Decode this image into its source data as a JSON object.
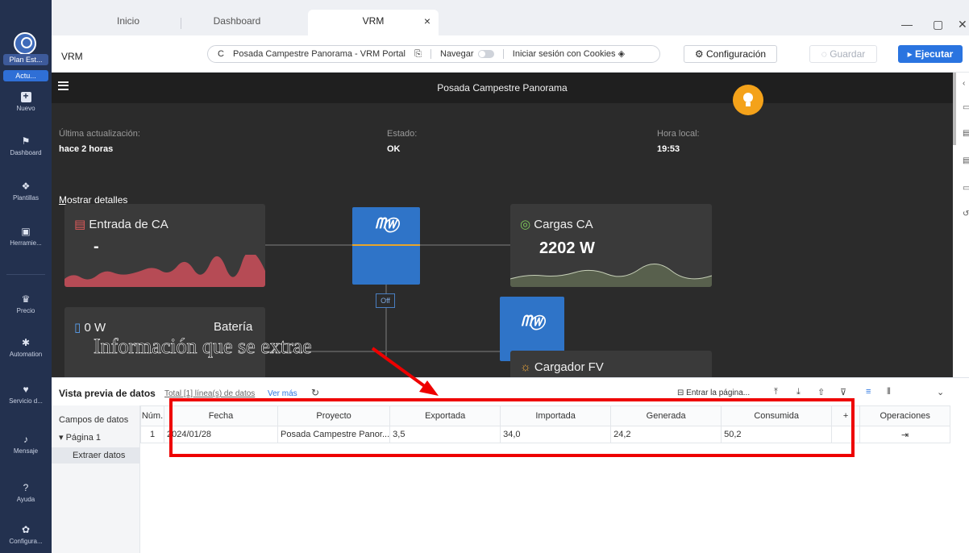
{
  "sidebar": {
    "plan_label": "Plan Est...",
    "active_label": "Actu...",
    "items": [
      {
        "label": "Nuevo",
        "icon": "plus-square-icon"
      },
      {
        "label": "Dashboard",
        "icon": "dashboard-icon"
      },
      {
        "label": "Plantillas",
        "icon": "templates-icon"
      },
      {
        "label": "Herramie...",
        "icon": "toolbox-icon"
      },
      {
        "label": "Precio",
        "icon": "crown-icon"
      },
      {
        "label": "Automation",
        "icon": "robot-icon"
      },
      {
        "label": "Servicio d...",
        "icon": "service-icon"
      },
      {
        "label": "Mensaje",
        "icon": "bell-icon"
      },
      {
        "label": "Ayuda",
        "icon": "help-icon"
      },
      {
        "label": "Configura...",
        "icon": "settings-icon"
      }
    ]
  },
  "tabs": [
    {
      "label": "Inicio"
    },
    {
      "label": "Dashboard"
    },
    {
      "label": "VRM",
      "close": "×"
    }
  ],
  "window": {
    "minimize": "—",
    "maximize": "▢",
    "close": "✕"
  },
  "toolbar": {
    "site_label": "VRM",
    "refresh_glyph": "C",
    "address": "Posada Campestre Panorama - VRM Portal",
    "navigate_label": "Navegar",
    "cookie_label": "Iniciar sesión con Cookies",
    "config_button": "Configuración",
    "save_button": "Guardar",
    "run_button": "Ejecutar"
  },
  "portal": {
    "title": "Posada Campestre Panorama",
    "last_update_label": "Última actualización:",
    "last_update_value": "hace 2 horas",
    "status_label": "Estado:",
    "status_value": "OK",
    "local_time_label": "Hora local:",
    "local_time_value": "19:53",
    "show_details": "Mostrar detalles",
    "cards": {
      "ac_input": {
        "title": "Entrada de CA",
        "value": "-"
      },
      "ac_loads": {
        "title": "Cargas CA",
        "value": "2202 W"
      },
      "battery": {
        "title": "Batería",
        "power": "0 W",
        "value": "-"
      },
      "pv_charger": {
        "title": "Cargador FV"
      }
    },
    "off_badge": "Off",
    "annotation": "Información que se extrae"
  },
  "preview": {
    "title": "Vista previa de datos",
    "total": "Total [1] línea(s) de datos",
    "more": "Ver más",
    "enter_page": "Entrar la página...",
    "left": {
      "fields": "Campos de datos",
      "page": "Página 1",
      "extract": "Extraer datos"
    },
    "columns": [
      "Núm.",
      "Fecha",
      "Proyecto",
      "Exportada",
      "Importada",
      "Generada",
      "Consumida",
      "+",
      "Operaciones"
    ],
    "rows": [
      {
        "num": "1",
        "fecha": "2024/01/28",
        "proyecto": "Posada Campestre Panor...",
        "exportada": "3,5",
        "importada": "34,0",
        "generada": "24,2",
        "consumida": "50,2"
      }
    ]
  },
  "colors": {
    "accent": "#2a74e0",
    "sidebar": "#23314f",
    "portal_bg": "#2b2b2b",
    "victron_blue": "#2f74c8",
    "annotation_red": "#e00000",
    "bulb": "#f4a21a"
  }
}
